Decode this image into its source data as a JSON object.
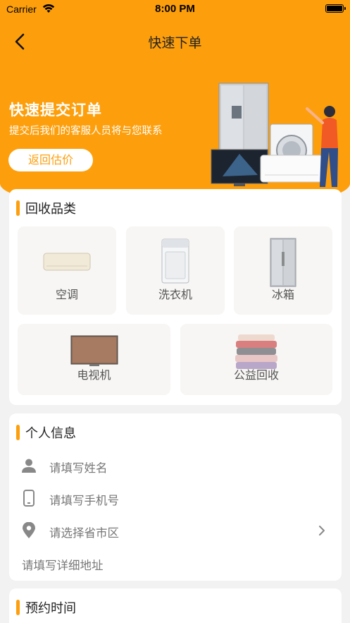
{
  "status_bar": {
    "carrier": "Carrier",
    "time": "8:00 PM"
  },
  "nav": {
    "title": "快速下单"
  },
  "hero": {
    "title": "快速提交订单",
    "subtitle": "提交后我们的客服人员将与您联系",
    "button": "返回估价"
  },
  "categories": {
    "title": "回收品类",
    "items": [
      {
        "label": "空调",
        "icon": "air-conditioner"
      },
      {
        "label": "洗衣机",
        "icon": "washing-machine"
      },
      {
        "label": "冰箱",
        "icon": "refrigerator"
      },
      {
        "label": "电视机",
        "icon": "television"
      },
      {
        "label": "公益回收",
        "icon": "clothes-pile"
      }
    ]
  },
  "personal": {
    "title": "个人信息",
    "name_placeholder": "请填写姓名",
    "phone_placeholder": "请填写手机号",
    "region_placeholder": "请选择省市区",
    "address_placeholder": "请填写详细地址"
  },
  "appointment": {
    "title": "预约时间"
  },
  "colors": {
    "accent": "#fd9f0c",
    "card": "#ffffff",
    "tile": "#f7f6f4",
    "background": "#f2f2f2"
  }
}
